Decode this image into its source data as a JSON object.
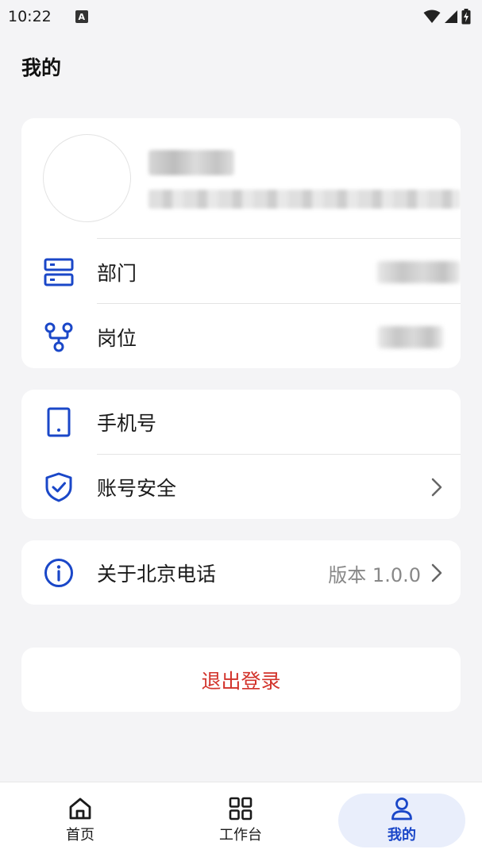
{
  "status_bar": {
    "time": "10:22",
    "notification_glyph": "A"
  },
  "page": {
    "title": "我的"
  },
  "profile": {
    "rows": [
      {
        "icon": "server-icon",
        "label": "部门"
      },
      {
        "icon": "org-branch-icon",
        "label": "岗位"
      }
    ]
  },
  "account": {
    "phone_label": "手机号",
    "security_label": "账号安全"
  },
  "about": {
    "label": "关于北京电话",
    "version": "版本 1.0.0"
  },
  "logout": {
    "label": "退出登录"
  },
  "nav": {
    "items": [
      {
        "label": "首页",
        "icon": "home-icon"
      },
      {
        "label": "工作台",
        "icon": "grid-icon"
      },
      {
        "label": "我的",
        "icon": "person-icon",
        "active": true
      }
    ]
  },
  "colors": {
    "accent": "#1a47c8",
    "danger": "#d2332b",
    "background": "#f4f4f6",
    "nav_active_bg": "#e9eefb"
  }
}
